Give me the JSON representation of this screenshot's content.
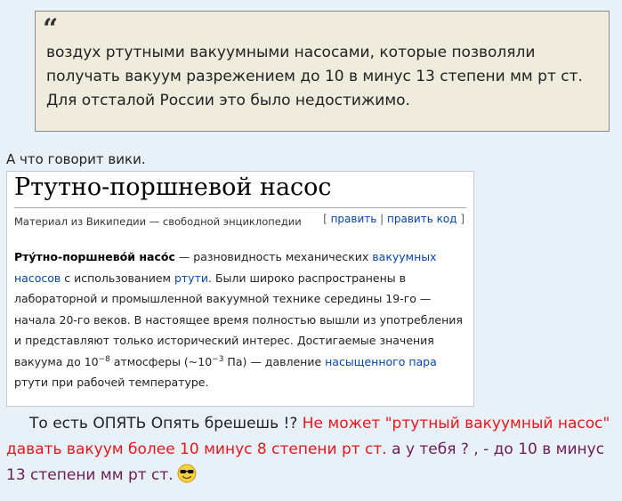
{
  "quote": {
    "mark": "“",
    "text": "воздух ртутными вакуумными насосами, которые позволяли получать вакуум разрежением до 10 в минус 13 степени мм рт ст. Для отсталой России это было недостижимо."
  },
  "lead_text": "А что говорит вики.",
  "wiki": {
    "title": "Ртутно-поршневой насос",
    "subtitle": "Материал из Википедии — свободной энциклопедии",
    "edit": {
      "open": "[",
      "edit_label": "править",
      "sep": "|",
      "edit_code_label": "править код",
      "close": "]"
    },
    "body": {
      "term": "Рту́тно-поршнево́й насо́с",
      "t1": " — разновидность механических ",
      "link_vacuum": "вакуумных насосов",
      "t2": " с использованием ",
      "link_mercury": "ртути",
      "t3": ". Были широко распространены в лабораторной и промышленной вакуумной технике середины 19-го — начала 20-го веков. В настоящее время полностью вышли из употребления и представляют только исторический интерес. Достигаемые значения вакуума до 10",
      "sup1": "−8",
      "t4": " атмосферы (~10",
      "sup2": "−3",
      "t5": " Па) — давление ",
      "link_saturated": "насыщенного пара",
      "t6": " ртути при рабочей температуре."
    }
  },
  "reply": {
    "part1": "То есть ОПЯТЬ Опять брешешь !? ",
    "part2_red": "Не может \"ртутный вакуумный насос\" давать вакуум более 10 минус 8 степени рт ст.",
    "part3_purple": " а у тебя ? , - до 10 в минус 13 степени мм рт ст.",
    "emoji": "cool-smiley-icon"
  },
  "colors": {
    "page_bg": "#e9f1f8",
    "quote_bg": "#efecde",
    "link": "#0645ad",
    "red": "#e6171c",
    "purple": "#6c1c5a"
  }
}
